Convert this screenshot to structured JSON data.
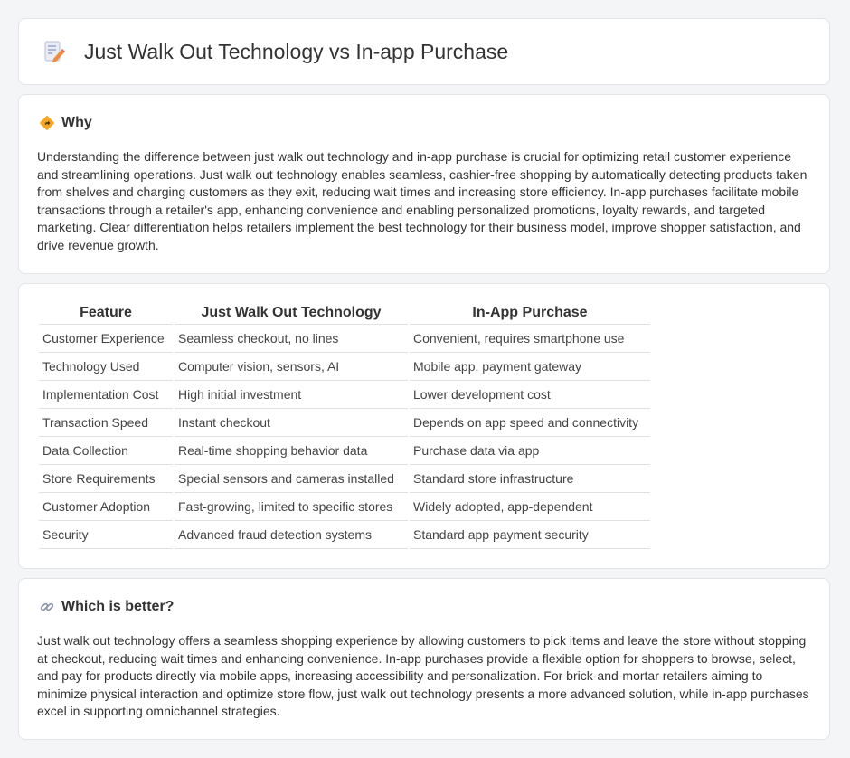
{
  "header": {
    "title": "Just Walk Out Technology vs In-app Purchase",
    "icon": "document-edit-icon"
  },
  "why": {
    "heading": "Why",
    "icon": "diamond-sign-icon",
    "body": "Understanding the difference between just walk out technology and in-app purchase is crucial for optimizing retail customer experience and streamlining operations. Just walk out technology enables seamless, cashier-free shopping by automatically detecting products taken from shelves and charging customers as they exit, reducing wait times and increasing store efficiency. In-app purchases facilitate mobile transactions through a retailer's app, enhancing convenience and enabling personalized promotions, loyalty rewards, and targeted marketing. Clear differentiation helps retailers implement the best technology for their business model, improve shopper satisfaction, and drive revenue growth."
  },
  "table": {
    "headers": [
      "Feature",
      "Just Walk Out Technology",
      "In-App Purchase"
    ],
    "rows": [
      [
        "Customer Experience",
        "Seamless checkout, no lines",
        "Convenient, requires smartphone use"
      ],
      [
        "Technology Used",
        "Computer vision, sensors, AI",
        "Mobile app, payment gateway"
      ],
      [
        "Implementation Cost",
        "High initial investment",
        "Lower development cost"
      ],
      [
        "Transaction Speed",
        "Instant checkout",
        "Depends on app speed and connectivity"
      ],
      [
        "Data Collection",
        "Real-time shopping behavior data",
        "Purchase data via app"
      ],
      [
        "Store Requirements",
        "Special sensors and cameras installed",
        "Standard store infrastructure"
      ],
      [
        "Customer Adoption",
        "Fast-growing, limited to specific stores",
        "Widely adopted, app-dependent"
      ],
      [
        "Security",
        "Advanced fraud detection systems",
        "Standard app payment security"
      ]
    ]
  },
  "better": {
    "heading": "Which is better?",
    "icon": "link-icon",
    "body": "Just walk out technology offers a seamless shopping experience by allowing customers to pick items and leave the store without stopping at checkout, reducing wait times and enhancing convenience. In-app purchases provide a flexible option for shoppers to browse, select, and pay for products directly via mobile apps, increasing accessibility and personalization. For brick-and-mortar retailers aiming to minimize physical interaction and optimize store flow, just walk out technology presents a more advanced solution, while in-app purchases excel in supporting omnichannel strategies."
  }
}
